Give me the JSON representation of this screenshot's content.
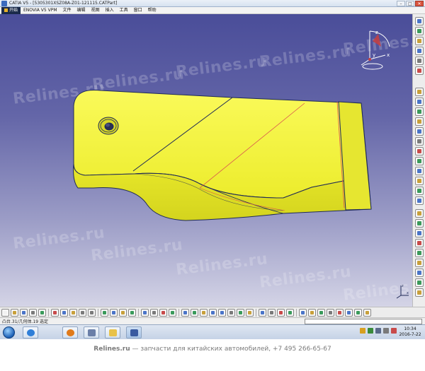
{
  "window": {
    "title": "CATIA V5 - [5305301XSZ08A-Z01-121115.CATPart]",
    "buttons": [
      "–",
      "□",
      "✕"
    ]
  },
  "menubar": {
    "items": [
      {
        "label": "开始",
        "icon": "start-menu-icon"
      },
      {
        "label": "ENOVIA V5 VPM"
      },
      {
        "label": "文件"
      },
      {
        "label": "编辑"
      },
      {
        "label": "视图"
      },
      {
        "label": "插入"
      },
      {
        "label": "工具"
      },
      {
        "label": "窗口"
      },
      {
        "label": "帮助"
      }
    ]
  },
  "viewport": {
    "background_top": "#4a4d99",
    "background_bottom": "#d4d4e6",
    "part_color": "#f2f23a",
    "edge_color": "#1f2a57",
    "sketch_line_color": "#d9534f",
    "compass_icon": "compass-icon",
    "axis_label_x": "x",
    "axis_label_y": "y",
    "axis_label_z": "z",
    "watermark": "Relines.ru"
  },
  "statusbar": {
    "text": "凸台.31/几何体.19 选定"
  },
  "taskbar": {
    "clock_time": "10:34",
    "clock_date": "2016-7-22",
    "apps": [
      "ie-icon",
      "media-player-icon",
      "catia-icon",
      "folder-icon",
      "catia-active-icon"
    ]
  },
  "footer": {
    "brand": "Relines.ru",
    "text": " — запчасти для китайских автомобилей, +7 495 266-65-67"
  }
}
